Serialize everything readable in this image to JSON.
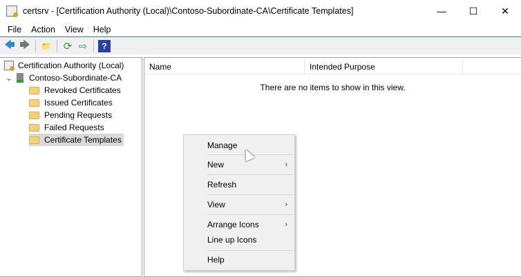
{
  "window": {
    "title": "certsrv - [Certification Authority (Local)\\Contoso-Subordinate-CA\\Certificate Templates]",
    "minimize": "—",
    "maximize": "☐",
    "close": "✕"
  },
  "menu": [
    "File",
    "Action",
    "View",
    "Help"
  ],
  "toolbar": {
    "back": "🡄",
    "forward": "🡆",
    "up": "📁",
    "refresh": "⟳",
    "export": "⇨",
    "help": "?"
  },
  "tree": {
    "root": "Certification Authority (Local)",
    "ca": "Contoso-Subordinate-CA",
    "expander": "⌄",
    "children": [
      "Revoked Certificates",
      "Issued Certificates",
      "Pending Requests",
      "Failed Requests",
      "Certificate Templates"
    ]
  },
  "list": {
    "columns": [
      "Name",
      "Intended Purpose"
    ],
    "empty_text": "There are no items to show in this view."
  },
  "context_menu": [
    {
      "label": "Manage"
    },
    {
      "label": "New",
      "submenu": true
    },
    {
      "label": "Refresh"
    },
    {
      "label": "View",
      "submenu": true
    },
    {
      "label": "Arrange Icons",
      "submenu": true
    },
    {
      "label": "Line up Icons"
    },
    {
      "label": "Help"
    }
  ],
  "submenu_arrow": "›"
}
